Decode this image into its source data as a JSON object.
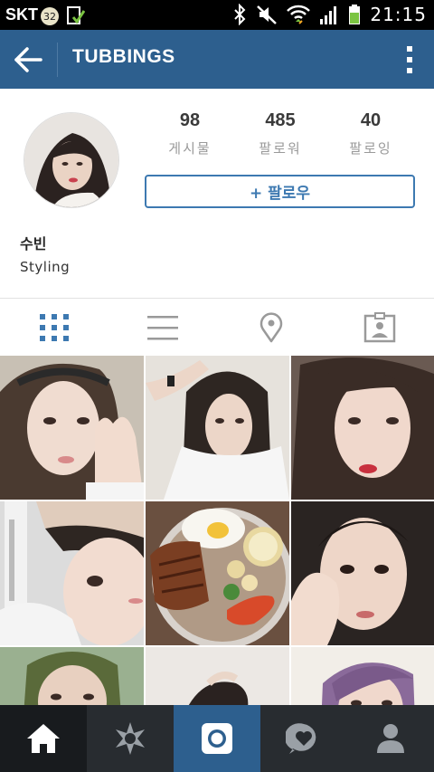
{
  "status_bar": {
    "carrier": "SKT",
    "badge_count": "32",
    "time": "21:15",
    "icons": [
      "bluetooth-icon",
      "mute-icon",
      "wifi-icon",
      "signal-icon",
      "battery-icon"
    ]
  },
  "app_bar": {
    "title": "TUBBINGS",
    "color": "#2d5f8e"
  },
  "profile": {
    "posts_count": "98",
    "posts_label": "게시물",
    "followers_count": "485",
    "followers_label": "팔로워",
    "following_count": "40",
    "following_label": "팔로잉",
    "follow_button": "+ 팔로우",
    "name": "수빈",
    "bio": "Styling"
  },
  "view_tabs": {
    "active": "grid",
    "items": [
      "grid-view-icon",
      "list-view-icon",
      "location-pin-icon",
      "tagged-photos-icon"
    ]
  },
  "bottom_nav": {
    "items": [
      "home-icon",
      "explore-icon",
      "camera-icon",
      "activity-icon",
      "profile-icon"
    ],
    "active": "home-icon",
    "camera_color": "#2d5f8e"
  },
  "colors": {
    "accent": "#3d79b1",
    "status_bar": "#000000",
    "bottom_nav": "#282c30"
  }
}
